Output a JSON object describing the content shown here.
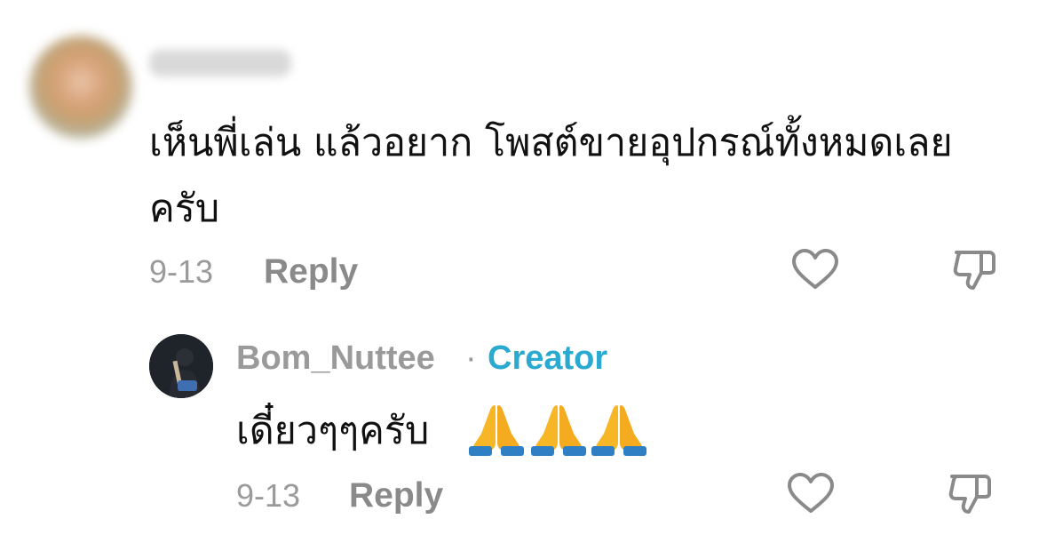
{
  "comment": {
    "text": "เห็นพี่เล่น แล้วอยาก โพสต์ขายอุปกรณ์ทั้งหมดเลยครับ",
    "date": "9-13",
    "reply_label": "Reply"
  },
  "reply": {
    "username": "Bom_Nuttee",
    "separator": "·",
    "badge": "Creator",
    "text": "เดี๋ยวๆๆครับ",
    "emojis": [
      "folded-hands",
      "folded-hands",
      "folded-hands"
    ],
    "date": "9-13",
    "reply_label": "Reply"
  },
  "icons": {
    "like": "heart-outline-icon",
    "dislike": "thumbs-down-outline-icon"
  },
  "colors": {
    "text": "#111111",
    "meta": "#9a9a9a",
    "creator_badge": "#2aa9d1"
  }
}
